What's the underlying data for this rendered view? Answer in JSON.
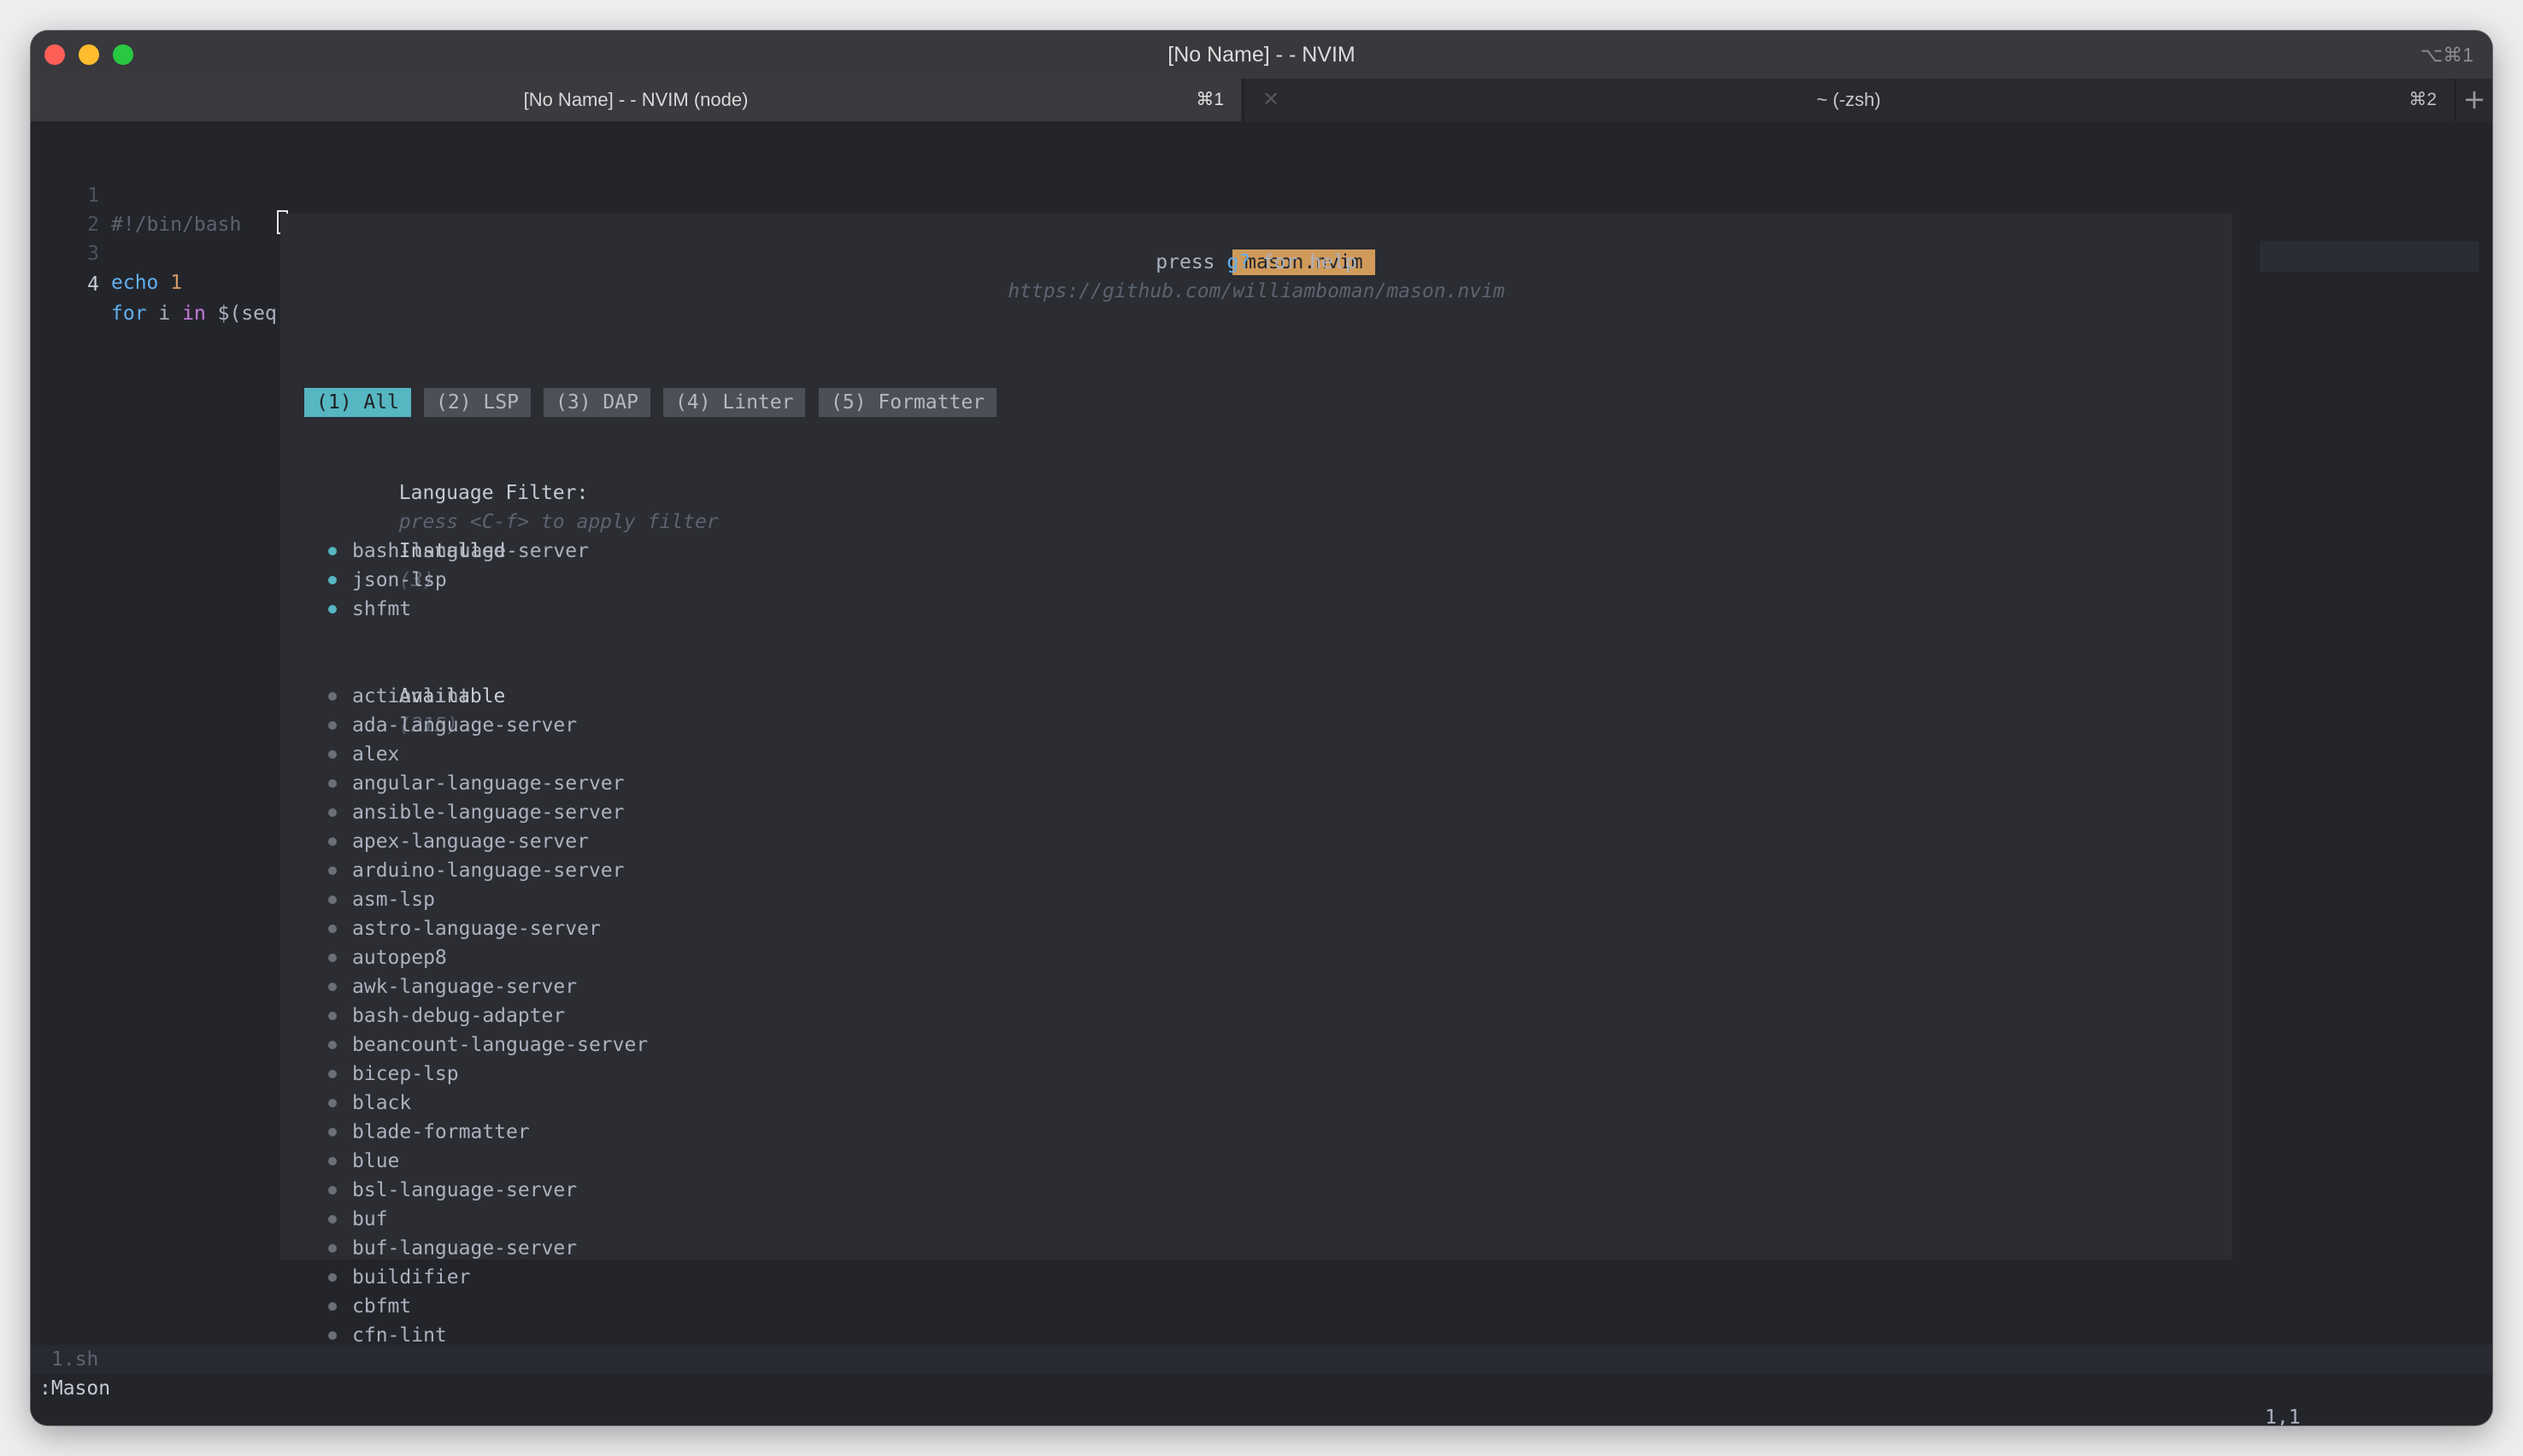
{
  "window": {
    "title": "[No Name] - - NVIM",
    "shortcut": "⌥⌘1"
  },
  "tabs": [
    {
      "label": "[No Name] - - NVIM (node)",
      "shortcut": "⌘1"
    },
    {
      "label": "~ (-zsh)",
      "shortcut": "⌘2",
      "close": "✕"
    }
  ],
  "new_tab_label": "+",
  "editor": {
    "lines": [
      {
        "num": "1",
        "text": "#!/bin/bash"
      },
      {
        "num": "2",
        "text": ""
      },
      {
        "num": "3",
        "kw": "echo",
        "arg": "1"
      },
      {
        "num": "4",
        "kw": "for",
        "mid": " i ",
        "kw2": "in",
        "rest": " $(seq"
      }
    ]
  },
  "mason": {
    "badge": "mason.nvim",
    "help_prefix": "press ",
    "help_key": "g?",
    "help_suffix": " for help",
    "url": "https://github.com/williamboman/mason.nvim",
    "tabs": [
      "(1) All",
      "(2) LSP",
      "(3) DAP",
      "(4) Linter",
      "(5) Formatter"
    ],
    "active_tab": "(1) All",
    "filter_label": "Language Filter:",
    "filter_hint": "press <C-f> to apply filter",
    "installed_label": "Installed",
    "installed_count": "(3)",
    "installed": [
      "bash-language-server",
      "json-lsp",
      "shfmt"
    ],
    "available_label": "Available",
    "available_count": "(215)",
    "available": [
      "actionlint",
      "ada-language-server",
      "alex",
      "angular-language-server",
      "ansible-language-server",
      "apex-language-server",
      "arduino-language-server",
      "asm-lsp",
      "astro-language-server",
      "autopep8",
      "awk-language-server",
      "bash-debug-adapter",
      "beancount-language-server",
      "bicep-lsp",
      "black",
      "blade-formatter",
      "blue",
      "bsl-language-server",
      "buf",
      "buf-language-server",
      "buildifier",
      "cbfmt",
      "cfn-lint"
    ]
  },
  "statusline": {
    "file": "1.sh"
  },
  "cmdline": ":Mason",
  "ruler": "1,1",
  "colors": {
    "background": "#23252b",
    "float": "#2b2d33",
    "accent": "#56b6c2",
    "badge": "#d09a5a"
  }
}
